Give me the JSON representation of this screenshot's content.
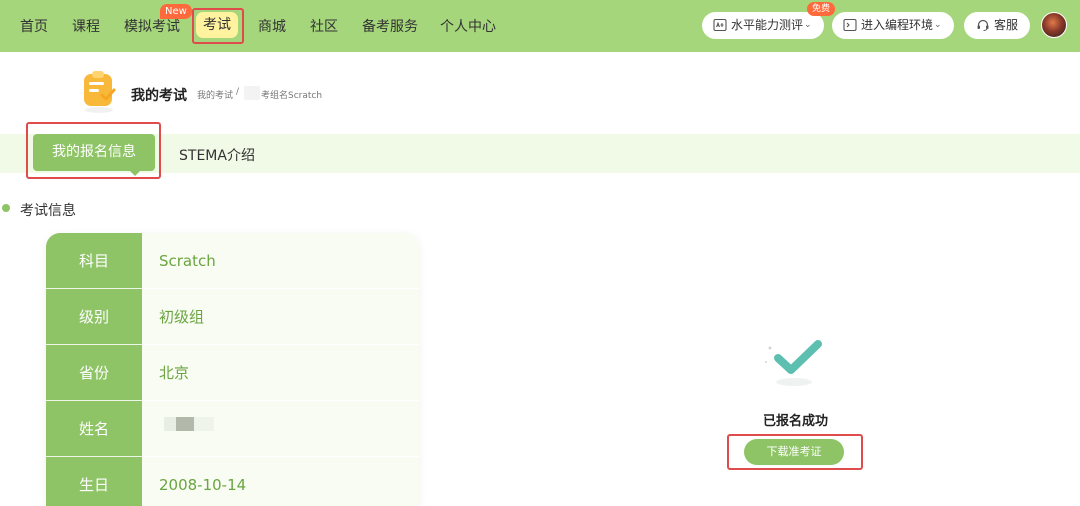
{
  "nav": {
    "items": [
      {
        "label": "首页"
      },
      {
        "label": "课程"
      },
      {
        "label": "模拟考试",
        "badge": "New"
      },
      {
        "label": "考试",
        "active": true
      },
      {
        "label": "商城"
      },
      {
        "label": "社区"
      },
      {
        "label": "备考服务"
      },
      {
        "label": "个人中心"
      }
    ]
  },
  "top_actions": {
    "assessment_label": "水平能力测评",
    "free_badge": "免费",
    "coding_env_label": "进入编程环境",
    "service_label": "客服"
  },
  "header": {
    "title": "我的考试",
    "breadcrumb_1": "我的考试",
    "breadcrumb_sep": "/",
    "breadcrumb_2": "考组名Scratch"
  },
  "tabs": [
    {
      "label": "我的报名信息",
      "active": true
    },
    {
      "label": "STEMA介绍"
    }
  ],
  "section": {
    "title": "考试信息"
  },
  "info_rows": [
    {
      "label": "科目",
      "value": "Scratch"
    },
    {
      "label": "级别",
      "value": "初级组"
    },
    {
      "label": "省份",
      "value": "北京"
    },
    {
      "label": "姓名",
      "value": ""
    },
    {
      "label": "生日",
      "value": "2008-10-14"
    }
  ],
  "status": {
    "success_text": "已报名成功",
    "download_label": "下载准考证"
  },
  "colors": {
    "nav_bg": "#a5d67b",
    "accent": "#8ec466",
    "active_nav_bg": "#fff3a0",
    "badge": "#ff6a3d",
    "highlight_box": "#e04c4c",
    "value_text": "#6aa53f"
  }
}
